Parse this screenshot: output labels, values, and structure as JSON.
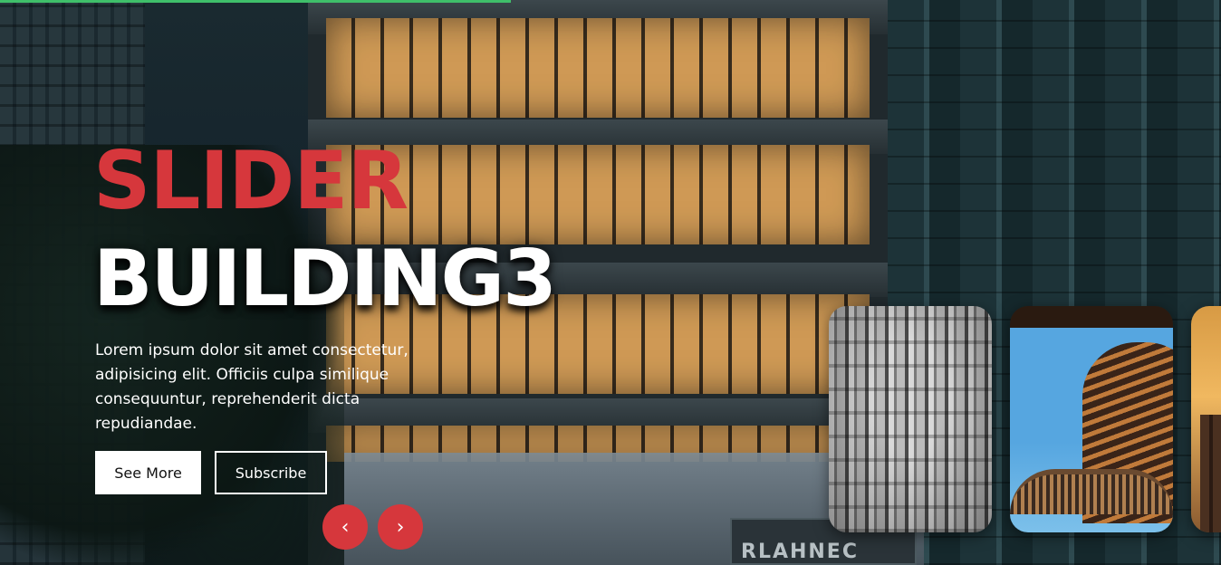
{
  "slide": {
    "title_top": "SLIDER",
    "title_main": "BUILDING3",
    "description": "Lorem ipsum dolor sit amet consectetur, adipisicing elit. Officiis culpa similique consequuntur, reprehenderit dicta repudiandae."
  },
  "buttons": {
    "see_more": "See More",
    "subscribe": "Subscribe"
  },
  "nav": {
    "prev_glyph": "‹",
    "next_glyph": "›"
  },
  "background": {
    "sign_text": "RLAHNEC"
  },
  "colors": {
    "accent": "#d6373c",
    "progress": "#3fbf6a",
    "text_light": "#ffffff"
  },
  "thumbnails": [
    {
      "name": "city-aerial-bw"
    },
    {
      "name": "curved-tower"
    },
    {
      "name": "sunset-skyline"
    }
  ]
}
